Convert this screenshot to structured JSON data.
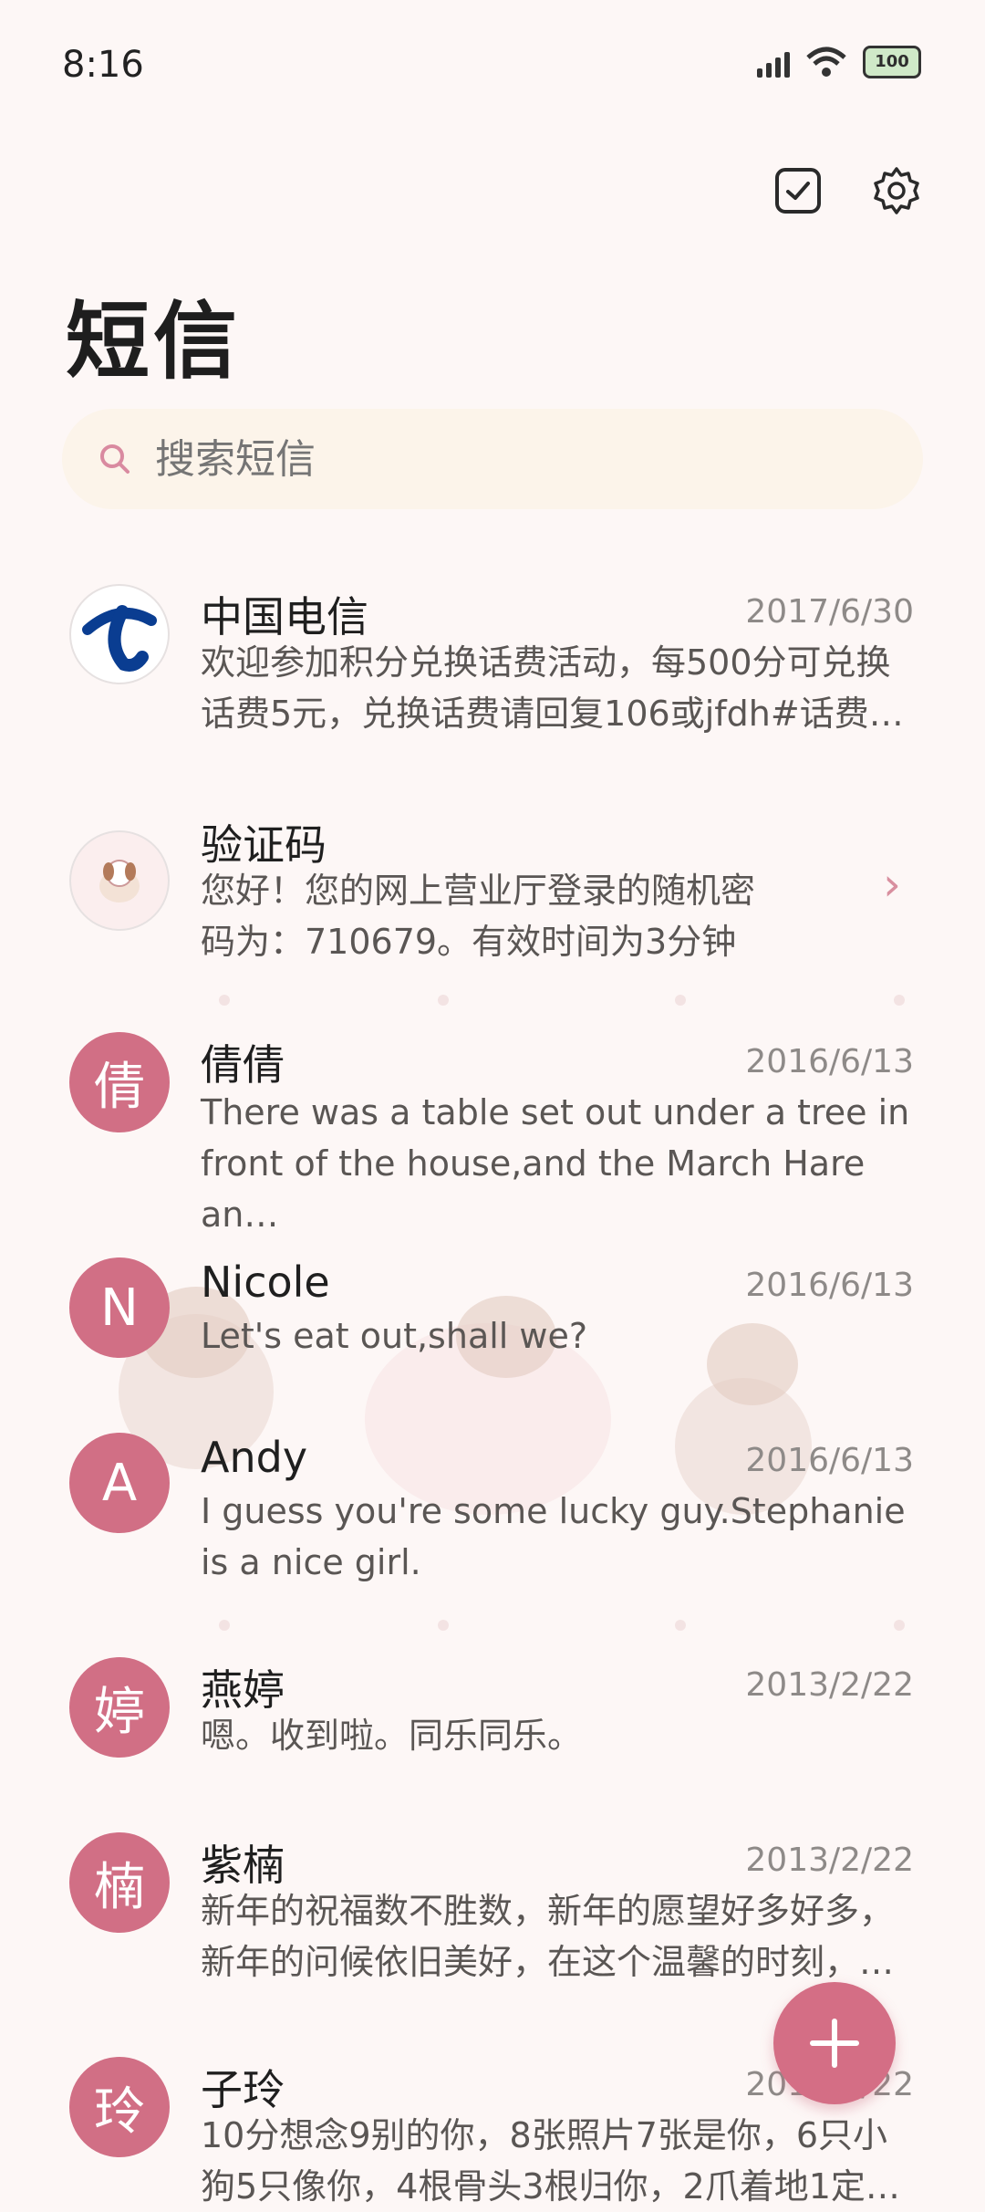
{
  "status": {
    "time": "8:16",
    "battery": "100"
  },
  "header": {
    "title": "短信"
  },
  "search": {
    "placeholder": "搜索短信"
  },
  "conversations": [
    {
      "name": "中国电信",
      "date": "2017/6/30",
      "preview": "欢迎参加积分兑换话费活动，每500分可兑换话费5元，兑换话费请回复106或jfdh#话费…",
      "avatar": "",
      "avatar_type": "telecom-logo"
    },
    {
      "name": "验证码",
      "date": "",
      "preview": "您好！您的网上营业厅登录的随机密码为：710679。有效时间为3分钟",
      "avatar": "",
      "avatar_type": "dog-image"
    },
    {
      "name": "倩倩",
      "date": "2016/6/13",
      "preview": "There was a table set out under a tree in front of the house,and the March Hare an…",
      "avatar": "倩"
    },
    {
      "name": "Nicole",
      "date": "2016/6/13",
      "preview": "Let's eat out,shall we?",
      "avatar": "N"
    },
    {
      "name": "Andy",
      "date": "2016/6/13",
      "preview": "I guess you're some lucky guy.Stephanie is a nice girl.",
      "avatar": "A"
    },
    {
      "name": "燕婷",
      "date": "2013/2/22",
      "preview": "嗯。收到啦。同乐同乐。",
      "avatar": "婷"
    },
    {
      "name": "紫楠",
      "date": "2013/2/22",
      "preview": "新年的祝福数不胜数，新年的愿望好多好多，新年的问候依旧美好，在这个温馨的时刻，…",
      "avatar": "楠"
    },
    {
      "name": "子玲",
      "date": "2013/2/22",
      "preview": "10分想念9别的你，8张照片7张是你，6只小狗5只像你，4根骨头3根归你，2爪着地1定…",
      "avatar": "玲"
    }
  ],
  "colors": {
    "accent": "#d46e85",
    "background": "#fdf7f6"
  },
  "icons": {
    "multiselect": "checkbox-icon",
    "settings": "gear-icon",
    "search": "search-icon",
    "compose": "plus-icon"
  }
}
